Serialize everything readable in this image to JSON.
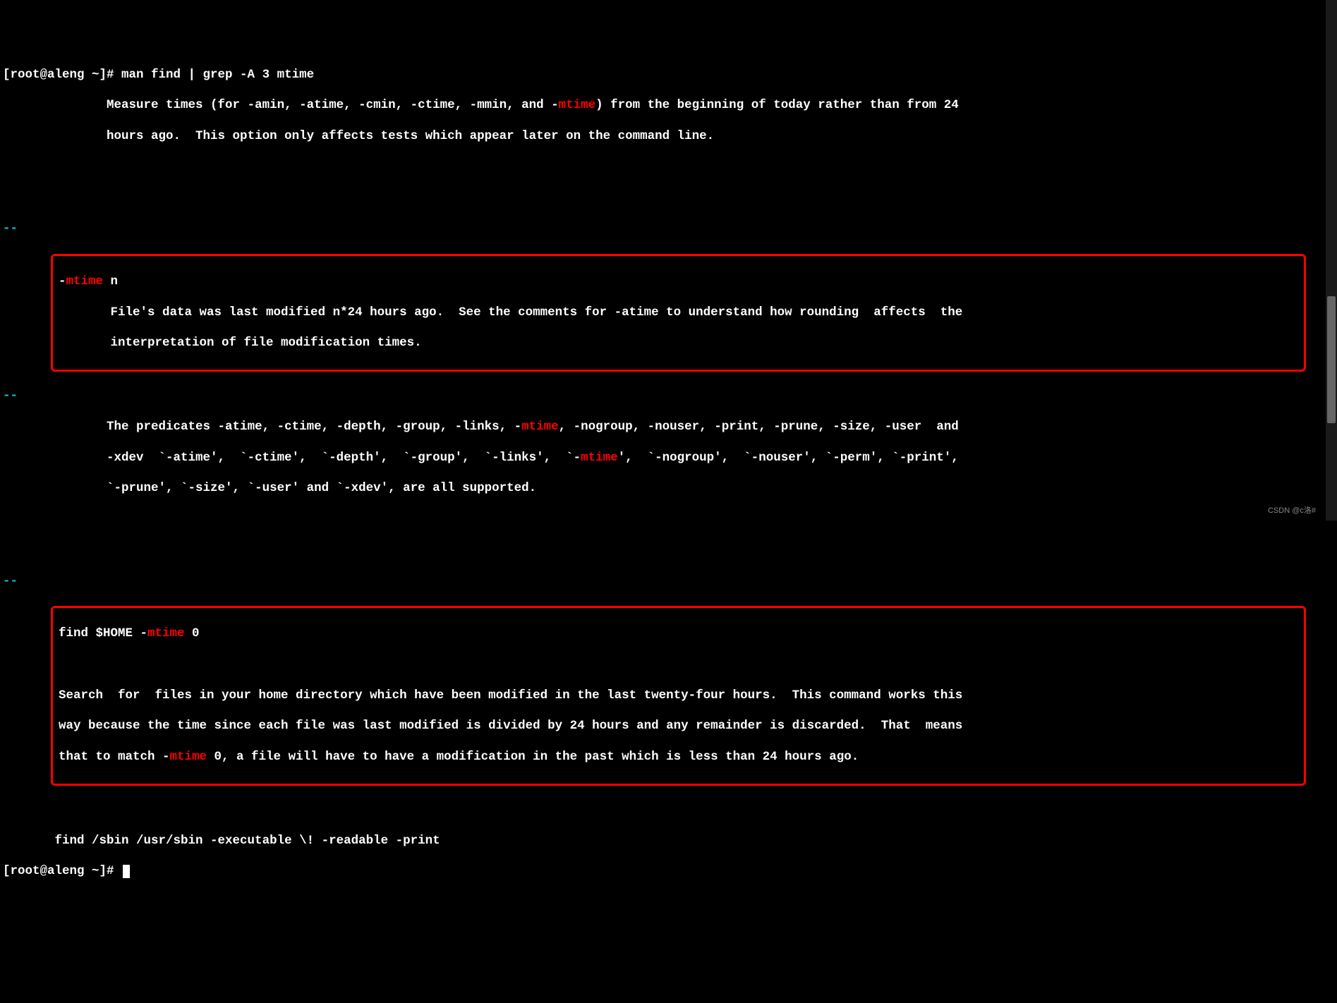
{
  "prompt1": {
    "open": "[root@aleng ~]# ",
    "cmd": "man find | grep -A 3 mtime"
  },
  "block1": {
    "indent": "              ",
    "t1a": "Measure times (for -amin, -atime, -cmin, -ctime, -mmin, and -",
    "hl1": "mtime",
    "t1b": ") from the beginning of today rather than from 24",
    "t2": "hours ago.  This option only affects tests which appear later on the command line."
  },
  "sep": "--",
  "box1": {
    "l1a": "-",
    "l1hl": "mtime",
    "l1b": " n",
    "indent": "       ",
    "l2": "File's data was last modified n*24 hours ago.  See the comments for -atime to understand how rounding  affects  the",
    "l3": "interpretation of file modification times."
  },
  "block2": {
    "indent": "              ",
    "t1a": "The predicates -atime, -ctime, -depth, -group, -links, -",
    "hl1": "mtime",
    "t1b": ", -nogroup, -nouser, -print, -prune, -size, -user  and",
    "t2a": "-xdev  `-atime',  `-ctime',  `-depth',  `-group',  `-links',  `-",
    "hl2": "mtime",
    "t2b": "',  `-nogroup',  `-nouser', `-perm', `-print',",
    "t3": "`-prune', `-size', `-user' and `-xdev', are all supported."
  },
  "box2": {
    "l1a": "find $HOME -",
    "l1hl": "mtime",
    "l1b": " 0",
    "blank": " ",
    "l2": "Search  for  files in your home directory which have been modified in the last twenty-four hours.  This command works this",
    "l3": "way because the time since each file was last modified is divided by 24 hours and any remainder is discarded.  That  means",
    "l4a": "that to match -",
    "l4hl": "mtime",
    "l4b": " 0, a file will have to have a modification in the past which is less than 24 hours ago."
  },
  "block3": {
    "indent": "       ",
    "t1": "find /sbin /usr/sbin -executable \\! -readable -print"
  },
  "prompt2": "[root@aleng ~]# ",
  "watermark": "CSDN @c洛#"
}
